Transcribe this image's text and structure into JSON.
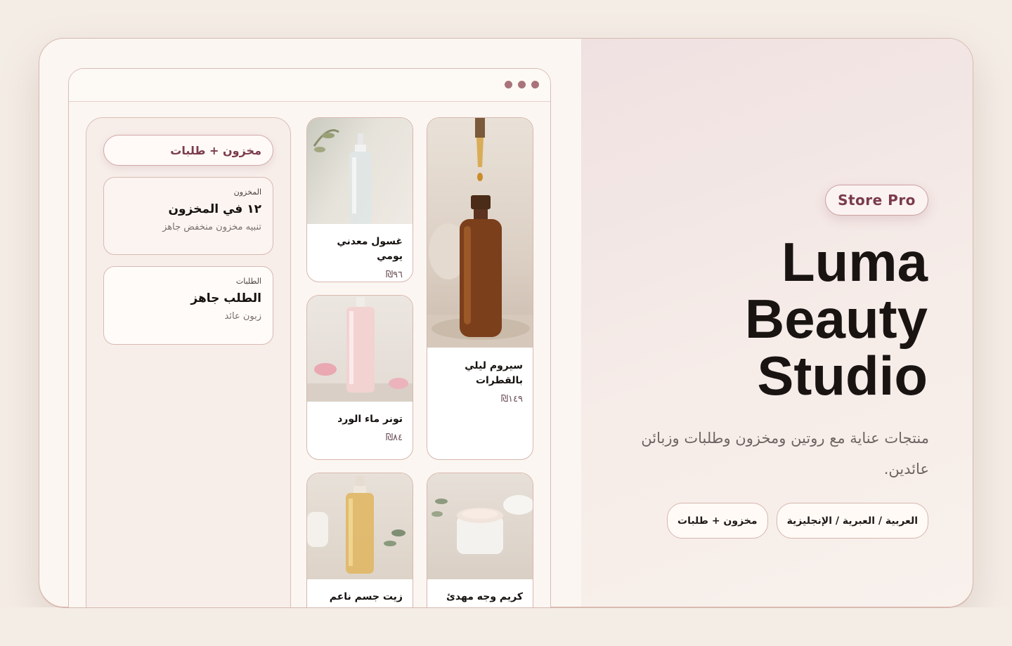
{
  "hero": {
    "badge": "Store Pro",
    "title_lines": [
      "Luma",
      "Beauty",
      "Studio"
    ],
    "description": "منتجات عناية مع روتين ومخزون وطلبات وزبائن عائدين.",
    "tags": [
      "العربية / العبرية / الإنجليزية",
      "مخزون + طلبات"
    ]
  },
  "sidebar": {
    "pill": "مخزون + طلبات",
    "cards": [
      {
        "label": "المخزون",
        "title": "١٢ في المخزون",
        "sub": "تنبيه مخزون منخفض جاهز"
      },
      {
        "label": "الطلبات",
        "title": "الطلب جاهز",
        "sub": "زبون عائد"
      }
    ]
  },
  "products": [
    {
      "name": "سيروم ليلي بالقطرات",
      "price": "١٤٩₪",
      "image": "serum-dropper-bottle"
    },
    {
      "name": "غسول معدني يومي",
      "price": "٩٦₪",
      "image": "cleanser-pump-bottle"
    },
    {
      "name": "تونر ماء الورد",
      "price": "٨٤₪",
      "image": "rose-toner-bottle"
    },
    {
      "name": "كريم وجه مهدئ",
      "price": "",
      "image": "cream-jar"
    },
    {
      "name": "زيت جسم ناعم",
      "price": "",
      "image": "body-oil-bottle"
    }
  ],
  "colors": {
    "accent": "#7b3b4d",
    "window_dots": "#a8747a",
    "border": "#d8b9b0",
    "ink": "#191412"
  }
}
